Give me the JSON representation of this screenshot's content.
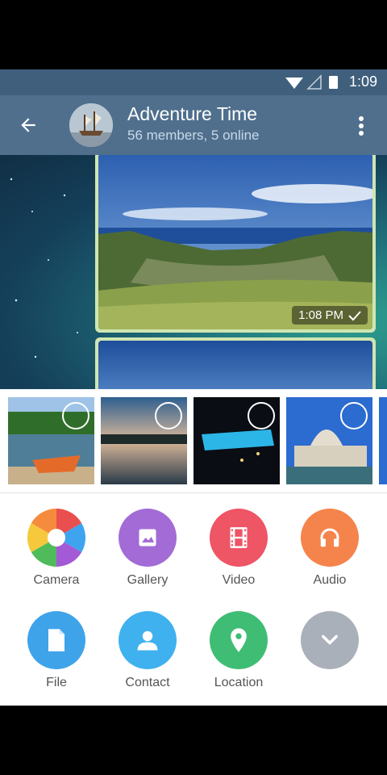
{
  "status_bar": {
    "time": "1:09"
  },
  "header": {
    "title": "Adventure Time",
    "subtitle": "56 members, 5 online"
  },
  "message": {
    "time": "1:08 PM"
  },
  "attach": {
    "actions_row1": [
      {
        "label": "Camera",
        "color": "multicolor",
        "icon": "camera-aperture-icon"
      },
      {
        "label": "Gallery",
        "color": "#a36bd6",
        "icon": "image-icon"
      },
      {
        "label": "Video",
        "color": "#ee5565",
        "icon": "film-icon"
      },
      {
        "label": "Audio",
        "color": "#f5844c",
        "icon": "headphones-icon"
      }
    ],
    "actions_row2": [
      {
        "label": "File",
        "color": "#3fa3ea",
        "icon": "file-icon"
      },
      {
        "label": "Contact",
        "color": "#3fb1ee",
        "icon": "person-icon"
      },
      {
        "label": "Location",
        "color": "#3fbd74",
        "icon": "location-pin-icon"
      },
      {
        "label": "",
        "color": "#aab0b9",
        "icon": "chevron-down-icon"
      }
    ]
  }
}
